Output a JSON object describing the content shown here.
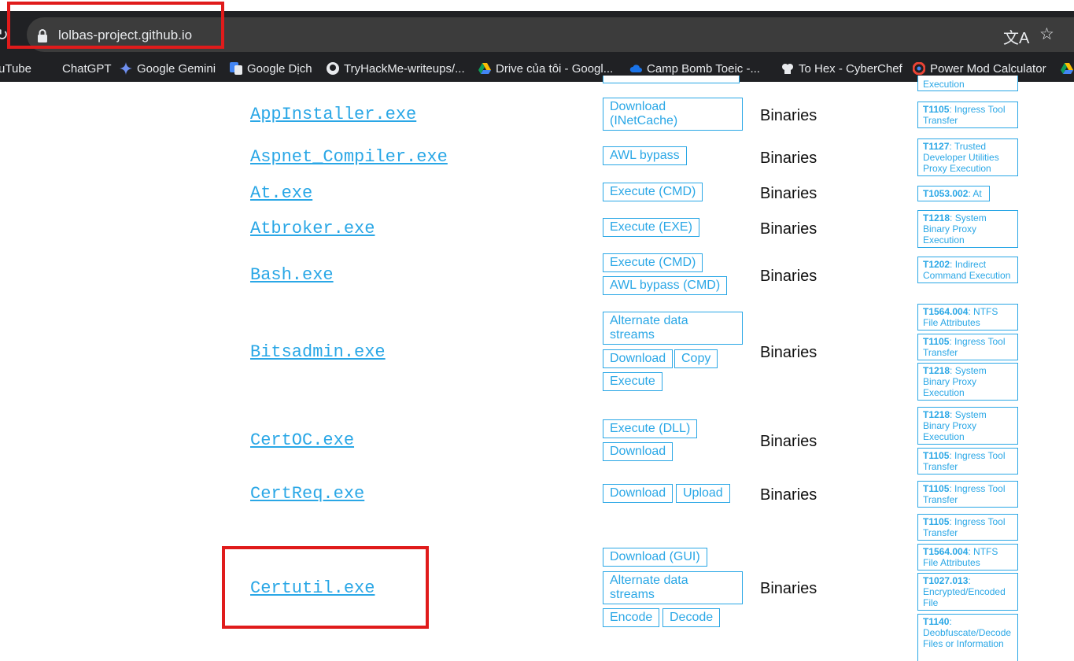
{
  "browser": {
    "url": "lolbas-project.github.io",
    "bookmarks": [
      {
        "label": "uTube",
        "icon": "youtube-icon"
      },
      {
        "label": "ChatGPT",
        "icon": "chatgpt-icon"
      },
      {
        "label": "Google Gemini",
        "icon": "gemini-icon"
      },
      {
        "label": "Google Dịch",
        "icon": "google-translate-icon"
      },
      {
        "label": "TryHackMe-writeups/...",
        "icon": "github-icon"
      },
      {
        "label": "Drive của tôi - Googl...",
        "icon": "google-drive-icon"
      },
      {
        "label": "Camp Bomb Toeic -...",
        "icon": "cloud-icon"
      },
      {
        "label": "To Hex - CyberChef",
        "icon": "chef-hat-icon"
      },
      {
        "label": "Power Mod Calculator",
        "icon": "calculator-icon"
      }
    ]
  },
  "top_partial": {
    "att_tail": "Execution"
  },
  "rows": [
    {
      "name": "AppInstaller.exe",
      "functions": [
        "Download (INetCache)"
      ],
      "type": "Binaries",
      "attack": [
        {
          "id": "T1105",
          "desc": ": Ingress Tool Transfer"
        }
      ]
    },
    {
      "name": "Aspnet_Compiler.exe",
      "functions": [
        "AWL bypass"
      ],
      "type": "Binaries",
      "attack": [
        {
          "id": "T1127",
          "desc": ": Trusted Developer Utilities Proxy Execution"
        }
      ]
    },
    {
      "name": "At.exe",
      "functions": [
        "Execute (CMD)"
      ],
      "type": "Binaries",
      "attack": [
        {
          "id": "T1053.002",
          "desc": ": At"
        }
      ]
    },
    {
      "name": "Atbroker.exe",
      "functions": [
        "Execute (EXE)"
      ],
      "type": "Binaries",
      "attack": [
        {
          "id": "T1218",
          "desc": ": System Binary Proxy Execution"
        }
      ]
    },
    {
      "name": "Bash.exe",
      "functions": [
        "Execute (CMD)",
        "AWL bypass (CMD)"
      ],
      "type": "Binaries",
      "attack": [
        {
          "id": "T1202",
          "desc": ": Indirect Command Execution"
        }
      ]
    },
    {
      "name": "Bitsadmin.exe",
      "functions": [
        "Alternate data streams",
        "Download",
        "Copy",
        "Execute"
      ],
      "type": "Binaries",
      "attack": [
        {
          "id": "T1564.004",
          "desc": ": NTFS File Attributes"
        },
        {
          "id": "T1105",
          "desc": ": Ingress Tool Transfer"
        },
        {
          "id": "T1218",
          "desc": ": System Binary Proxy Execution"
        }
      ]
    },
    {
      "name": "CertOC.exe",
      "functions": [
        "Execute (DLL)",
        "Download"
      ],
      "type": "Binaries",
      "attack": [
        {
          "id": "T1218",
          "desc": ": System Binary Proxy Execution"
        },
        {
          "id": "T1105",
          "desc": ": Ingress Tool Transfer"
        }
      ]
    },
    {
      "name": "CertReq.exe",
      "functions": [
        "Download",
        "Upload"
      ],
      "type": "Binaries",
      "attack": [
        {
          "id": "T1105",
          "desc": ": Ingress Tool Transfer"
        },
        {
          "id": "T1105",
          "desc": ": Ingress Tool Transfer"
        }
      ]
    },
    {
      "name": "Certutil.exe",
      "functions": [
        "Download (GUI)",
        "Alternate data streams",
        "Encode",
        "Decode"
      ],
      "type": "Binaries",
      "attack": [
        {
          "id": "T1564.004",
          "desc": ": NTFS File Attributes"
        },
        {
          "id": "T1027.013",
          "desc": ": Encrypted/Encoded File"
        },
        {
          "id": "T1140",
          "desc": ": Deobfuscate/Decode Files or Information"
        }
      ]
    }
  ]
}
